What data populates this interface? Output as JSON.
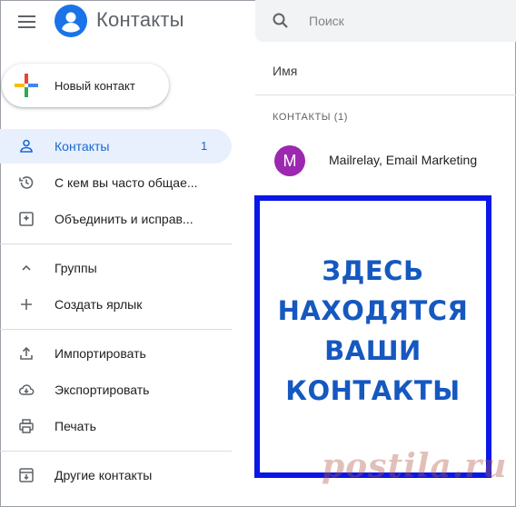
{
  "header": {
    "app_title": "Контакты",
    "search_placeholder": "Поиск"
  },
  "new_contact": {
    "label": "Новый контакт"
  },
  "sidebar": {
    "items": [
      {
        "label": "Контакты",
        "count": "1",
        "icon": "person-icon",
        "active": true
      },
      {
        "label": "С кем вы часто общае...",
        "icon": "history-icon"
      },
      {
        "label": "Объединить и исправ...",
        "icon": "merge-icon"
      },
      {
        "label": "Группы",
        "icon": "chevron-up-icon"
      },
      {
        "label": "Создать ярлык",
        "icon": "plus-icon"
      },
      {
        "label": "Импортировать",
        "icon": "upload-icon"
      },
      {
        "label": "Экспортировать",
        "icon": "cloud-download-icon"
      },
      {
        "label": "Печать",
        "icon": "printer-icon"
      },
      {
        "label": "Другие контакты",
        "icon": "archive-icon"
      }
    ]
  },
  "main": {
    "column_header": "Имя",
    "section_label": "КОНТАКТЫ (1)",
    "contacts": [
      {
        "initial": "M",
        "name": "Mailrelay, Email Marketing",
        "avatar_color": "#9c27b0"
      }
    ]
  },
  "annotation": {
    "lines": [
      "ЗДЕСЬ",
      "НАХОДЯТСЯ",
      "ВАШИ",
      "КОНТАКТЫ"
    ],
    "border_color": "#0a17e6",
    "text_color": "#1558c0"
  },
  "watermark": {
    "text": "postila.ru"
  },
  "colors": {
    "accent": "#1a73e8",
    "active_bg": "#e8f0fe",
    "active_text": "#1967d2"
  }
}
